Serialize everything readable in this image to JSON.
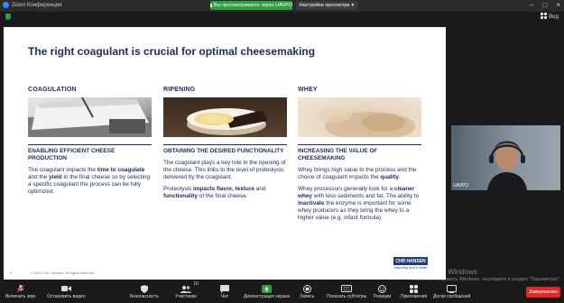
{
  "window": {
    "app_title": "Zoom Конференция",
    "share_banner": "Вы просматриваете экран UAVPO",
    "view_options": "Настройки просмотра",
    "view_label": "Вид"
  },
  "slide": {
    "title": "The right coagulant is crucial for optimal cheesemaking",
    "columns": [
      {
        "heading": "COAGULATION",
        "subheading": "ENABLING EFFICIENT CHEESE PRODUCTION",
        "p1": {
          "a": "The coagulant impacts the ",
          "b1": "time to coagulate",
          "c": " and the ",
          "b2": "yield",
          "d": " in the final cheese so by selecting a specific coagulant the process can be fully optimized."
        }
      },
      {
        "heading": "RIPENING",
        "subheading": "OBTAINING THE DESIRED FUNCTIONALITY",
        "p1": "The coagulant plays a key role in the ripening of the cheese. This links to the level of proteolysis delivered by the coagulant.",
        "p2": {
          "a": "Proteolysis ",
          "b1": "impacts flavor, texture",
          "c": " and ",
          "b2": "functionality",
          "d": " of the final cheese."
        }
      },
      {
        "heading": "WHEY",
        "subheading": "INCREASING THE VALUE OF CHEESEMAKING",
        "p1": {
          "a": "Whey brings high value to the process and the choice of coagulant impacts the ",
          "b1": "quality",
          "c": "."
        },
        "p2": {
          "a": "Whey processors generally look for a ",
          "b1": "cleaner whey",
          "c": " with less sediments and fat. The ability to ",
          "b2": "inactivate",
          "d": " the enzyme is important for some whey producers as they bring the whey to a higher value (e.g. infant formula)."
        }
      }
    ],
    "page_number": "5",
    "copyright": "© 2021 Chr. Hansen. All rights reserved.",
    "logo_text": "CHR HANSEN",
    "logo_tagline": "Improving food & health"
  },
  "participant": {
    "name": "UAVPO"
  },
  "watermark": {
    "line1": "Активация Windows",
    "line2": "Чтобы активировать Windows, перейдите в раздел \"Параметры\"."
  },
  "toolbar": {
    "items": [
      {
        "label": "Включить звук",
        "icon": "mic-muted-icon"
      },
      {
        "label": "Остановить видео",
        "icon": "video-icon"
      },
      {
        "label": "Безопасность",
        "icon": "shield-icon"
      },
      {
        "label": "Участники",
        "icon": "participants-icon",
        "count": "10"
      },
      {
        "label": "Чат",
        "icon": "chat-icon"
      },
      {
        "label": "Демонстрация экрана",
        "icon": "share-screen-icon"
      },
      {
        "label": "Запись",
        "icon": "record-icon"
      },
      {
        "label": "Показать субтитры",
        "icon": "cc-icon"
      },
      {
        "label": "Реакции",
        "icon": "reactions-icon"
      },
      {
        "label": "Приложения",
        "icon": "apps-icon"
      },
      {
        "label": "Доски сообщений",
        "icon": "whiteboard-icon"
      }
    ],
    "end_label": "Завершение"
  },
  "colors": {
    "share_green": "#2ea043",
    "end_red": "#e02828",
    "slide_navy": "#1e2a5a",
    "zoom_blue": "#2d8cff"
  }
}
